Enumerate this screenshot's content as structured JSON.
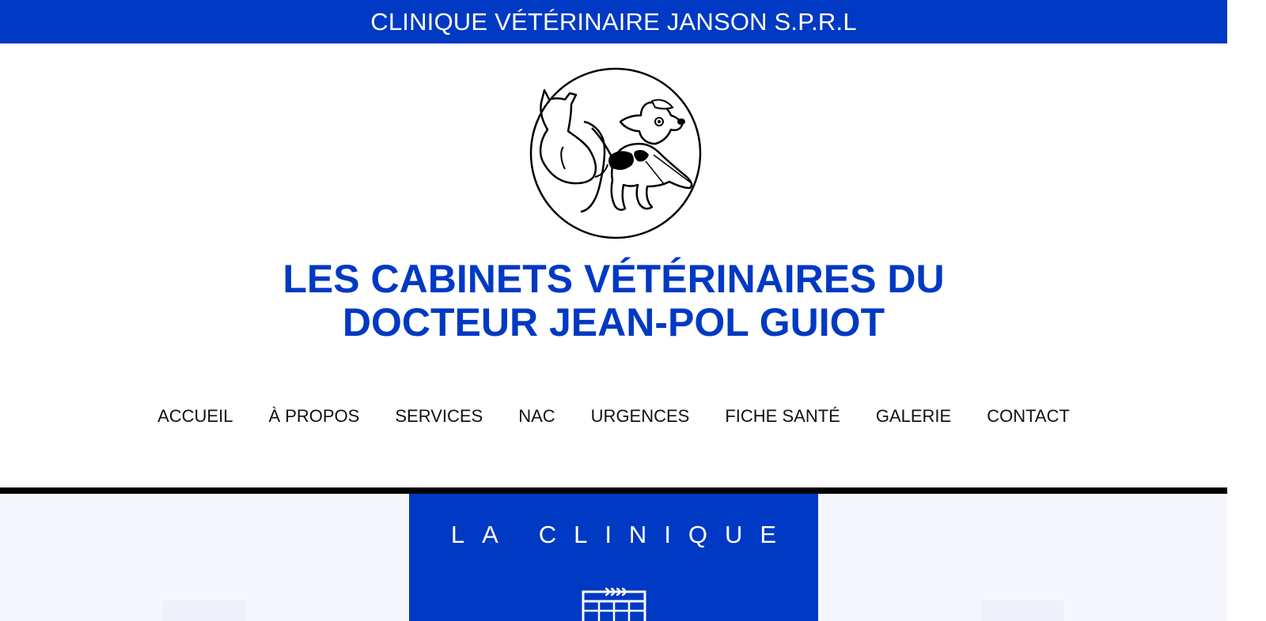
{
  "header": {
    "topbar_title": "CLINIQUE VÉTÉRINAIRE JANSON S.P.R.L",
    "main_title_line1": "LES CABINETS VÉTÉRINAIRES DU",
    "main_title_line2": "DOCTEUR JEAN-POL GUIOT"
  },
  "nav": {
    "items": [
      {
        "label": "ACCUEIL"
      },
      {
        "label": "À PROPOS"
      },
      {
        "label": "SERVICES"
      },
      {
        "label": "NAC"
      },
      {
        "label": "URGENCES"
      },
      {
        "label": "FICHE SANTÉ"
      },
      {
        "label": "GALERIE"
      },
      {
        "label": "CONTACT"
      }
    ]
  },
  "sections": {
    "clinic_title": "LA CLINIQUE",
    "clinic_icon": "calendar-icon"
  },
  "colors": {
    "brand_blue": "#0039c3",
    "text_dark": "#111111",
    "divider": "#000000",
    "band_bg": "#f5f7fd"
  }
}
